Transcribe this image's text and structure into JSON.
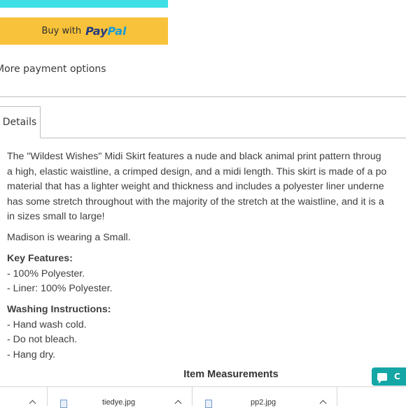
{
  "paypal_button": {
    "buy_with": "Buy with",
    "brand_pay": "Pay",
    "brand_pal": "Pal"
  },
  "more_payment_options": "More payment options",
  "tabs": [
    {
      "label": "Details"
    }
  ],
  "description": {
    "intro_lines": [
      "The \"Wildest Wishes\" Midi Skirt features a nude and black animal print pattern throug",
      "a high, elastic waistline, a crimped design, and a midi length. This skirt is made of a po",
      "material that has a lighter weight and thickness and includes a polyester liner underne",
      "has some stretch throughout with the majority of the stretch at the waistline, and it is a",
      "in sizes small to large!"
    ],
    "model_note": "Madison is wearing a Small.",
    "key_features": {
      "heading": "Key Features:",
      "items": [
        "- 100% Polyester.",
        "- Liner: 100% Polyester."
      ]
    },
    "washing": {
      "heading": "Washing Instructions:",
      "items": [
        "- Hand wash cold.",
        "- Do not bleach.",
        "- Hang dry."
      ]
    }
  },
  "item_measurements_title": "Item Measurements",
  "chat_button": {
    "label": "C"
  },
  "downloads": [
    {
      "name": "tiedye.jpg"
    },
    {
      "name": "pp2.jpg"
    }
  ]
}
